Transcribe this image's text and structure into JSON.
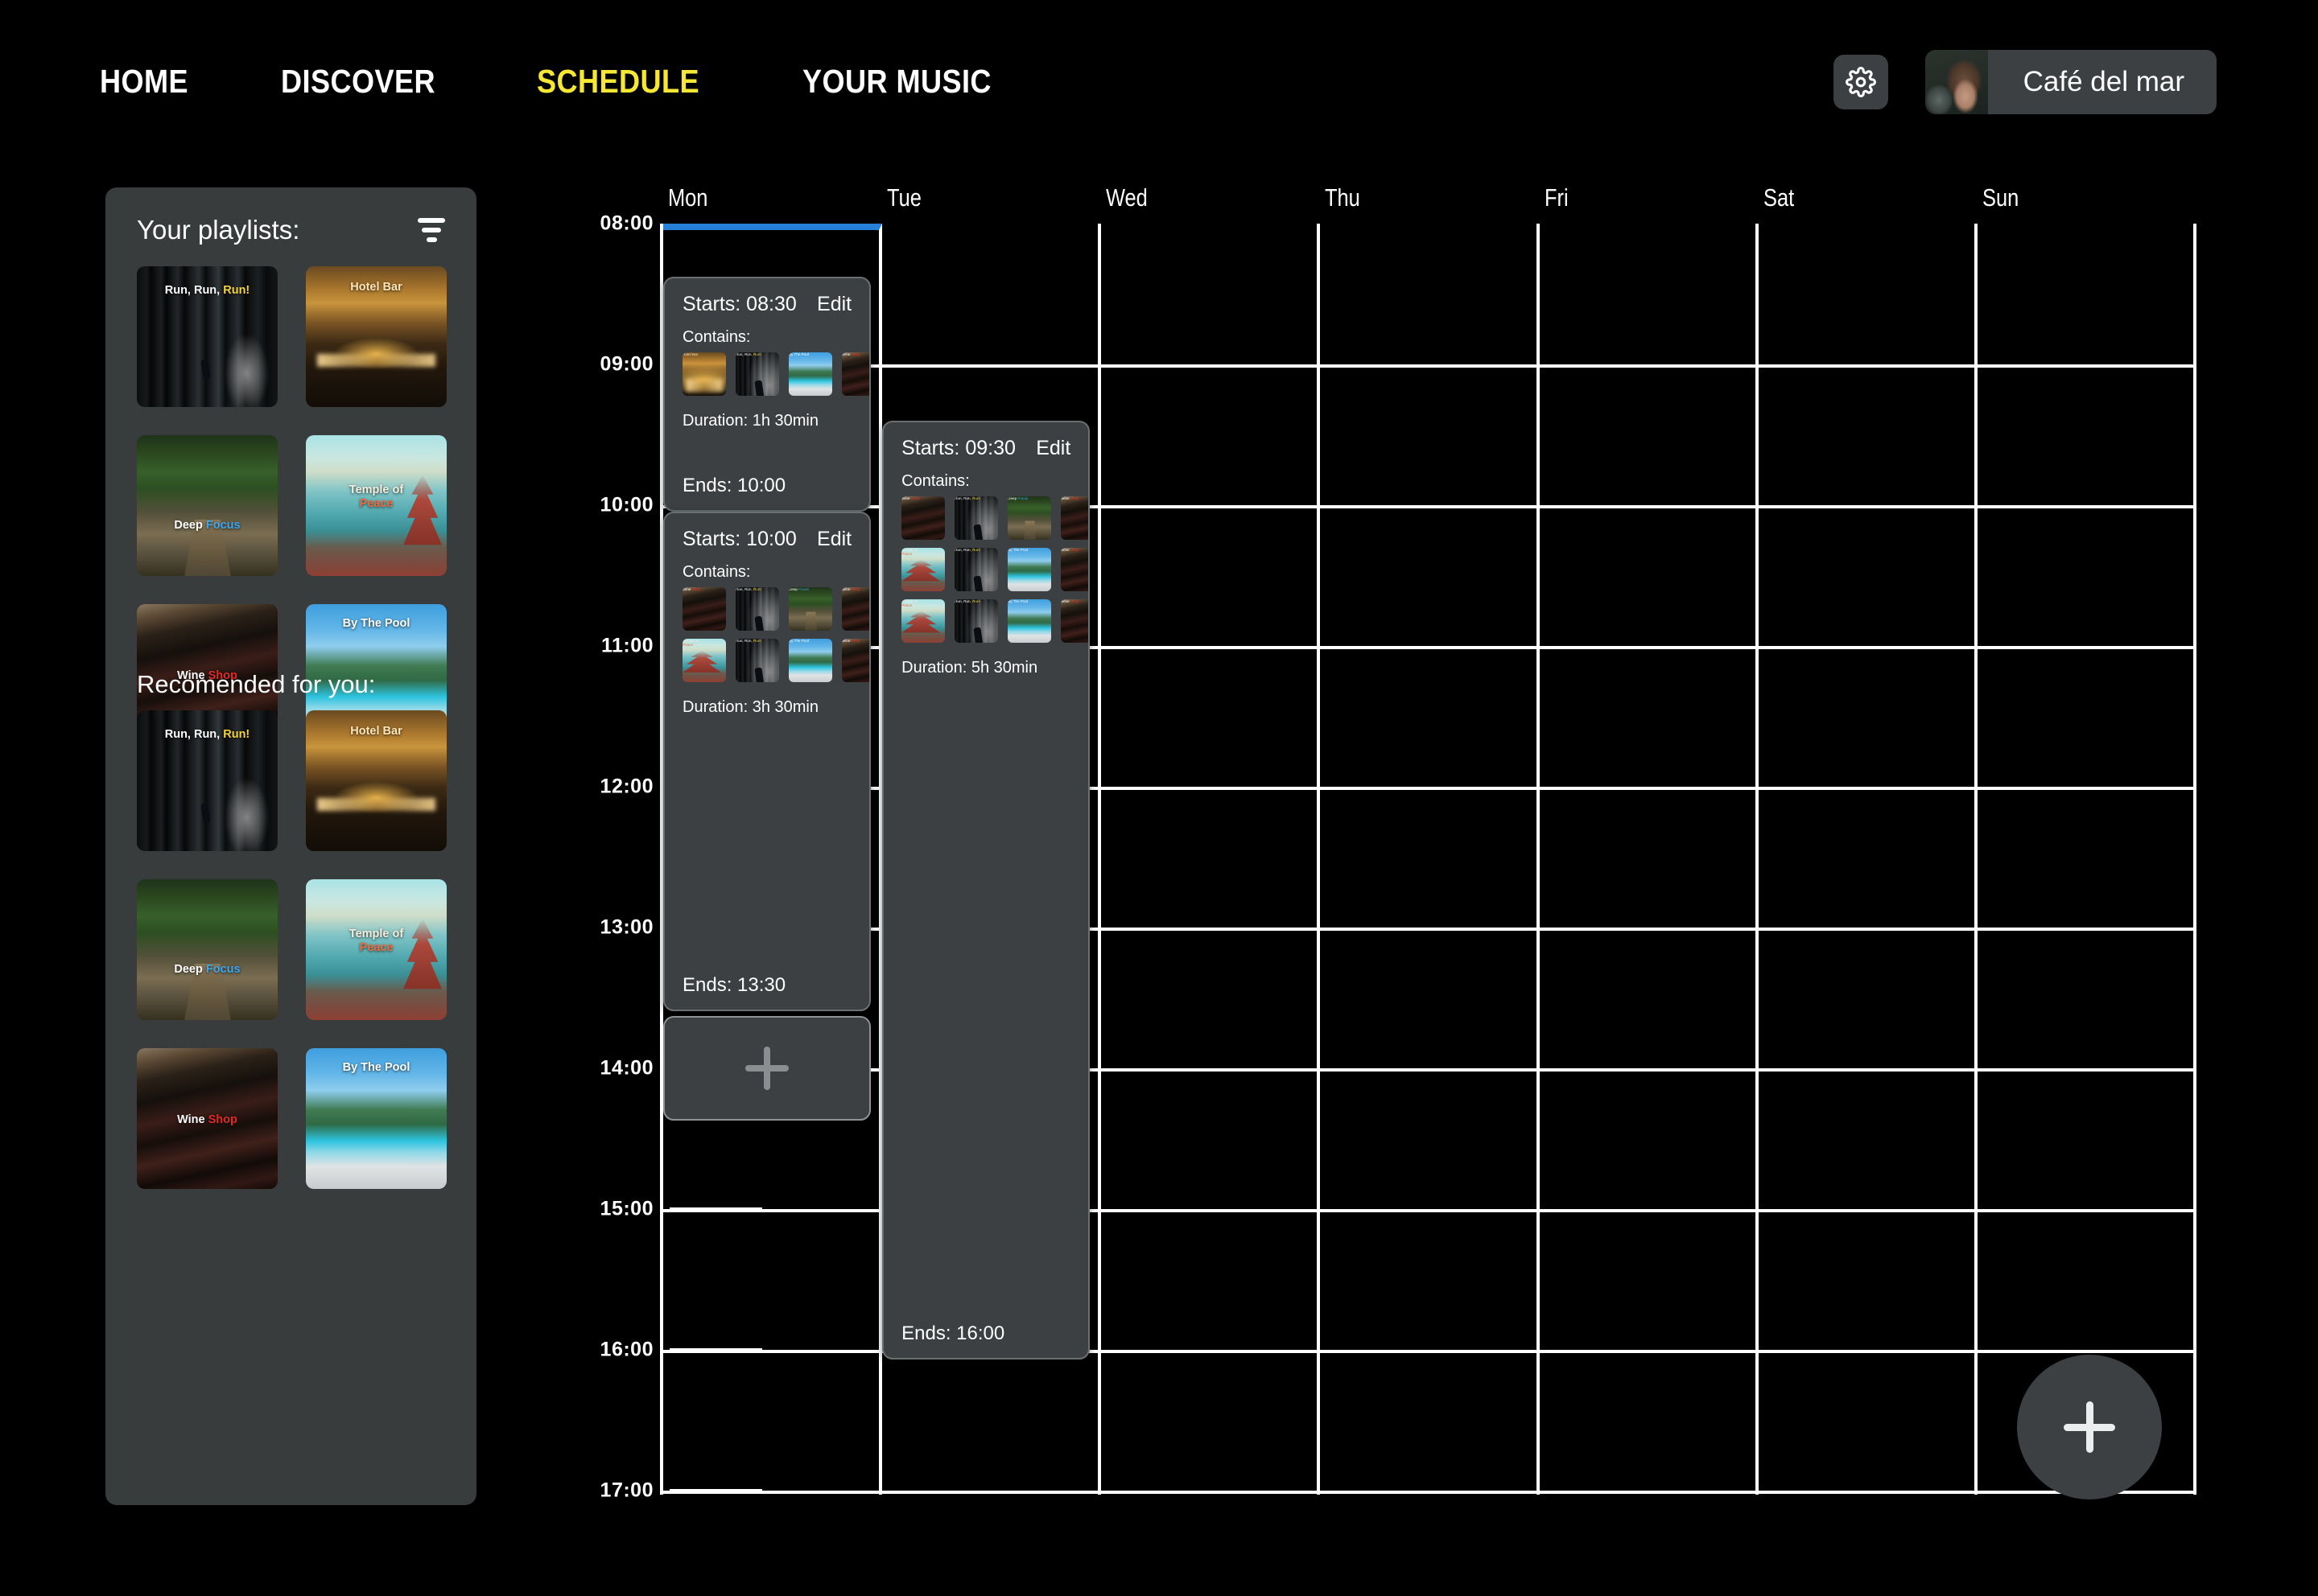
{
  "nav": {
    "items": [
      {
        "label": "HOME",
        "active": false
      },
      {
        "label": "DISCOVER",
        "active": false
      },
      {
        "label": "SCHEDULE",
        "active": true
      },
      {
        "label": "YOUR MUSIC",
        "active": false
      }
    ],
    "active_color": "#f5e733"
  },
  "topbar": {
    "settings_icon": "gear-icon",
    "profile": {
      "name": "Café del mar",
      "avatar_icon": "user-avatar"
    }
  },
  "sidebar": {
    "title": "Your playlists:",
    "filter_icon": "filter-icon",
    "recommended_title": "Recomended for you:",
    "playlists": [
      {
        "title_plain": "Run, Run, ",
        "title_accent": "Run!",
        "art": "art-run"
      },
      {
        "title_plain": "Hotel Bar",
        "title_accent": "",
        "art": "art-hotel"
      },
      {
        "title_plain": "Deep ",
        "title_accent": "Focus",
        "art": "art-focus"
      },
      {
        "title_plain": "Temple of ",
        "title_accent": "Peace",
        "art": "art-temple"
      },
      {
        "title_plain": "Wine",
        "title_accent": " Shop",
        "art": "art-wine"
      },
      {
        "title_plain": "By The Pool",
        "title_accent": "",
        "art": "art-pool"
      }
    ],
    "recommended": [
      {
        "title_plain": "Run, Run, ",
        "title_accent": "Run!",
        "art": "art-run"
      },
      {
        "title_plain": "Hotel Bar",
        "title_accent": "",
        "art": "art-hotel"
      },
      {
        "title_plain": "Deep ",
        "title_accent": "Focus",
        "art": "art-focus"
      },
      {
        "title_plain": "Temple of ",
        "title_accent": "Peace",
        "art": "art-temple"
      },
      {
        "title_plain": "Wine",
        "title_accent": " Shop",
        "art": "art-wine"
      },
      {
        "title_plain": "By The Pool",
        "title_accent": "",
        "art": "art-pool"
      }
    ]
  },
  "schedule": {
    "days": [
      "Mon",
      "Tue",
      "Wed",
      "Thu",
      "Fri",
      "Sat",
      "Sun"
    ],
    "today": "Mon",
    "today_marker_color": "#2680d8",
    "times": [
      "08:00",
      "09:00",
      "10:00",
      "11:00",
      "12:00",
      "13:00",
      "14:00",
      "15:00",
      "16:00",
      "17:00"
    ],
    "labels": {
      "starts": "Starts:",
      "ends": "Ends:",
      "duration": "Duration:",
      "contains": "Contains:",
      "edit": "Edit"
    },
    "events": [
      {
        "day": "Mon",
        "starts": "Starts: 08:30",
        "edit": "Edit",
        "contains": "Contains:",
        "duration": "Duration: 1h 30min",
        "ends": "Ends: 10:00",
        "tracks": [
          "art-hotel",
          "art-run",
          "art-pool",
          "art-wine"
        ]
      },
      {
        "day": "Mon",
        "starts": "Starts: 10:00",
        "edit": "Edit",
        "contains": "Contains:",
        "duration": "Duration: 3h 30min",
        "ends": "Ends: 13:30",
        "tracks": [
          "art-wine",
          "art-run",
          "art-focus",
          "art-wine",
          "art-temple",
          "art-run",
          "art-pool",
          "art-wine"
        ]
      },
      {
        "day": "Tue",
        "starts": "Starts: 09:30",
        "edit": "Edit",
        "contains": "Contains:",
        "duration": "Duration: 5h 30min",
        "ends": "Ends: 16:00",
        "tracks": [
          "art-wine",
          "art-run",
          "art-focus",
          "art-wine",
          "art-temple",
          "art-run",
          "art-pool",
          "art-wine",
          "art-temple",
          "art-run",
          "art-pool",
          "art-wine"
        ]
      }
    ],
    "add_slot_icon": "plus-icon",
    "fab_icon": "plus-icon"
  },
  "art_titles": {
    "art-run": {
      "plain": "Run, Run, ",
      "accent": "Run!"
    },
    "art-hotel": {
      "plain": "Hotel Bar",
      "accent": ""
    },
    "art-focus": {
      "plain": "Deep ",
      "accent": "Focus"
    },
    "art-temple": {
      "plain": "Temple of ",
      "accent": "Peace"
    },
    "art-wine": {
      "plain": "Wine",
      "accent": " Shop"
    },
    "art-pool": {
      "plain": "By The Pool",
      "accent": ""
    }
  }
}
